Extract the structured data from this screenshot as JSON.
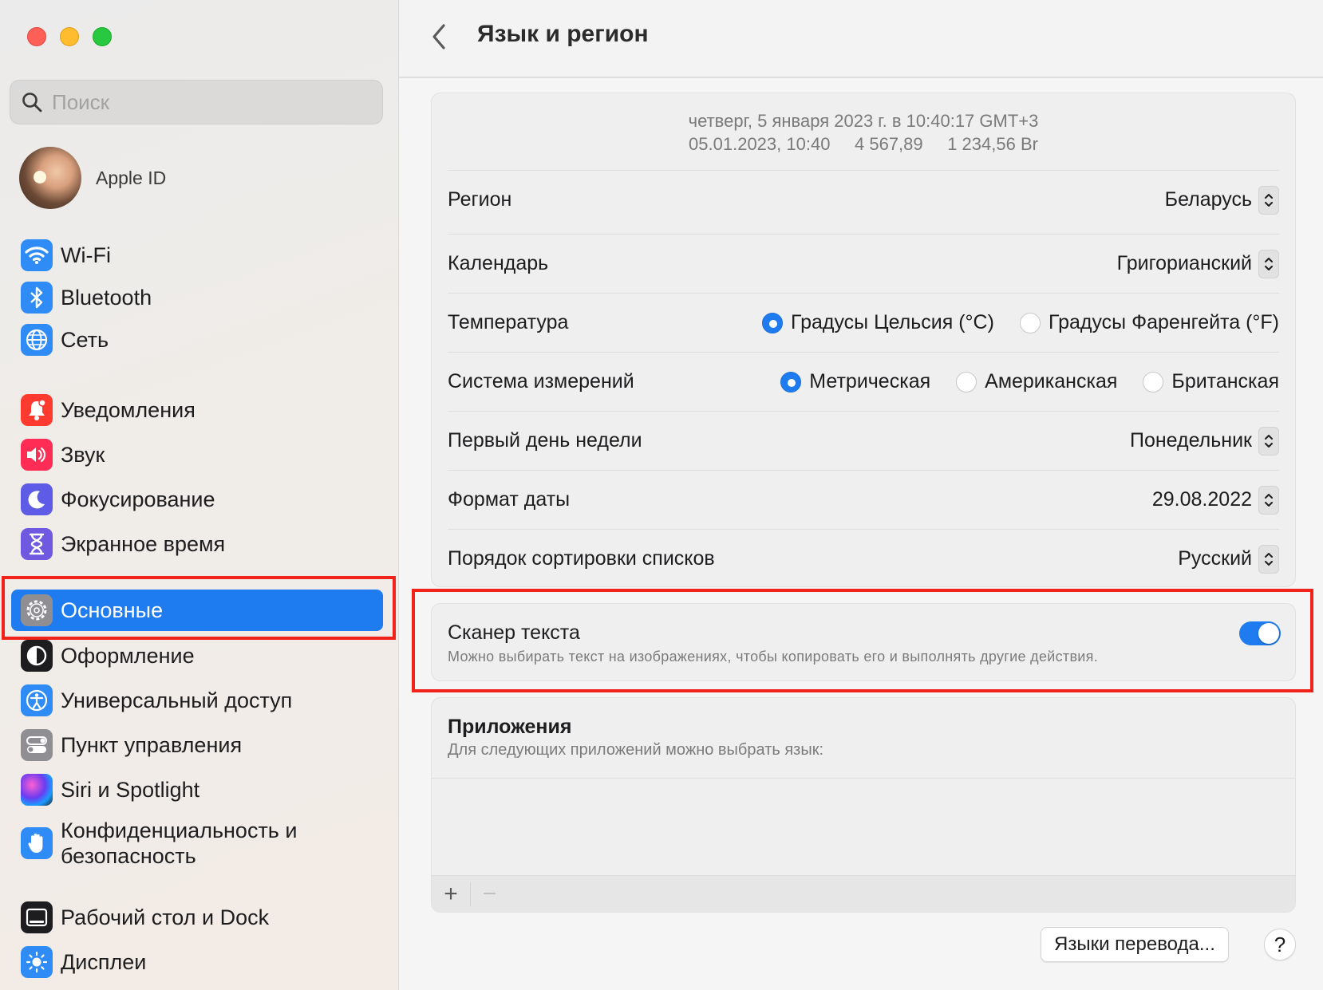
{
  "sidebar": {
    "search_placeholder": "Поиск",
    "apple_id_label": "Apple ID",
    "items": [
      {
        "label": "Wi-Fi",
        "icon": "wifi-icon",
        "color": "#2f8cf7"
      },
      {
        "label": "Bluetooth",
        "icon": "bluetooth-icon",
        "color": "#2f8cf7"
      },
      {
        "label": "Сеть",
        "icon": "globe-icon",
        "color": "#2f8cf7"
      },
      {
        "label": "Уведомления",
        "icon": "bell-icon",
        "color": "#ff3b30"
      },
      {
        "label": "Звук",
        "icon": "speaker-icon",
        "color": "#ff2d55"
      },
      {
        "label": "Фокусирование",
        "icon": "moon-icon",
        "color": "#5e5ce6"
      },
      {
        "label": "Экранное время",
        "icon": "hourglass-icon",
        "color": "#6e59e0"
      },
      {
        "label": "Основные",
        "icon": "gear-icon",
        "color": "#8e8e93",
        "selected": true
      },
      {
        "label": "Оформление",
        "icon": "appearance-icon",
        "color": "#1d1d1f"
      },
      {
        "label": "Универсальный доступ",
        "icon": "accessibility-icon",
        "color": "#2f8cf7"
      },
      {
        "label": "Пункт управления",
        "icon": "toggles-icon",
        "color": "#8e8e93"
      },
      {
        "label": "Siri и Spotlight",
        "icon": "siri-icon",
        "color": "#6a3cf0"
      },
      {
        "label": "Конфиденциальность и безопасность",
        "icon": "hand-icon",
        "color": "#2f8cf7"
      },
      {
        "label": "Рабочий стол и Dock",
        "icon": "dock-icon",
        "color": "#1d1d1f"
      },
      {
        "label": "Дисплеи",
        "icon": "sun-icon",
        "color": "#2f8cf7"
      }
    ]
  },
  "header": {
    "title": "Язык и регион"
  },
  "preview": {
    "line1": "четверг, 5 января 2023 г. в 10:40:17 GMT+3",
    "line2": "05.01.2023, 10:40     4 567,89     1 234,56 Br"
  },
  "settings": {
    "region": {
      "label": "Регион",
      "value": "Беларусь"
    },
    "calendar": {
      "label": "Календарь",
      "value": "Григорианский"
    },
    "temperature": {
      "label": "Температура",
      "options": [
        "Градусы Цельсия (°C)",
        "Градусы Фаренгейта (°F)"
      ],
      "selected": 0
    },
    "measurement": {
      "label": "Система измерений",
      "options": [
        "Метрическая",
        "Американская",
        "Британская"
      ],
      "selected": 0
    },
    "first_day": {
      "label": "Первый день недели",
      "value": "Понедельник"
    },
    "date_format": {
      "label": "Формат даты",
      "value": "29.08.2022"
    },
    "sort_order": {
      "label": "Порядок сортировки списков",
      "value": "Русский"
    }
  },
  "live_text": {
    "title": "Сканер текста",
    "description": "Можно выбирать текст на изображениях, чтобы копировать его и выполнять другие действия.",
    "enabled": true
  },
  "apps": {
    "title": "Приложения",
    "subtitle": "Для следующих приложений можно выбрать язык:",
    "add": "+",
    "remove": "−"
  },
  "footer": {
    "translation_button": "Языки перевода...",
    "help": "?"
  },
  "colors": {
    "accent": "#1f7cf0",
    "highlight": "#f1221a"
  }
}
